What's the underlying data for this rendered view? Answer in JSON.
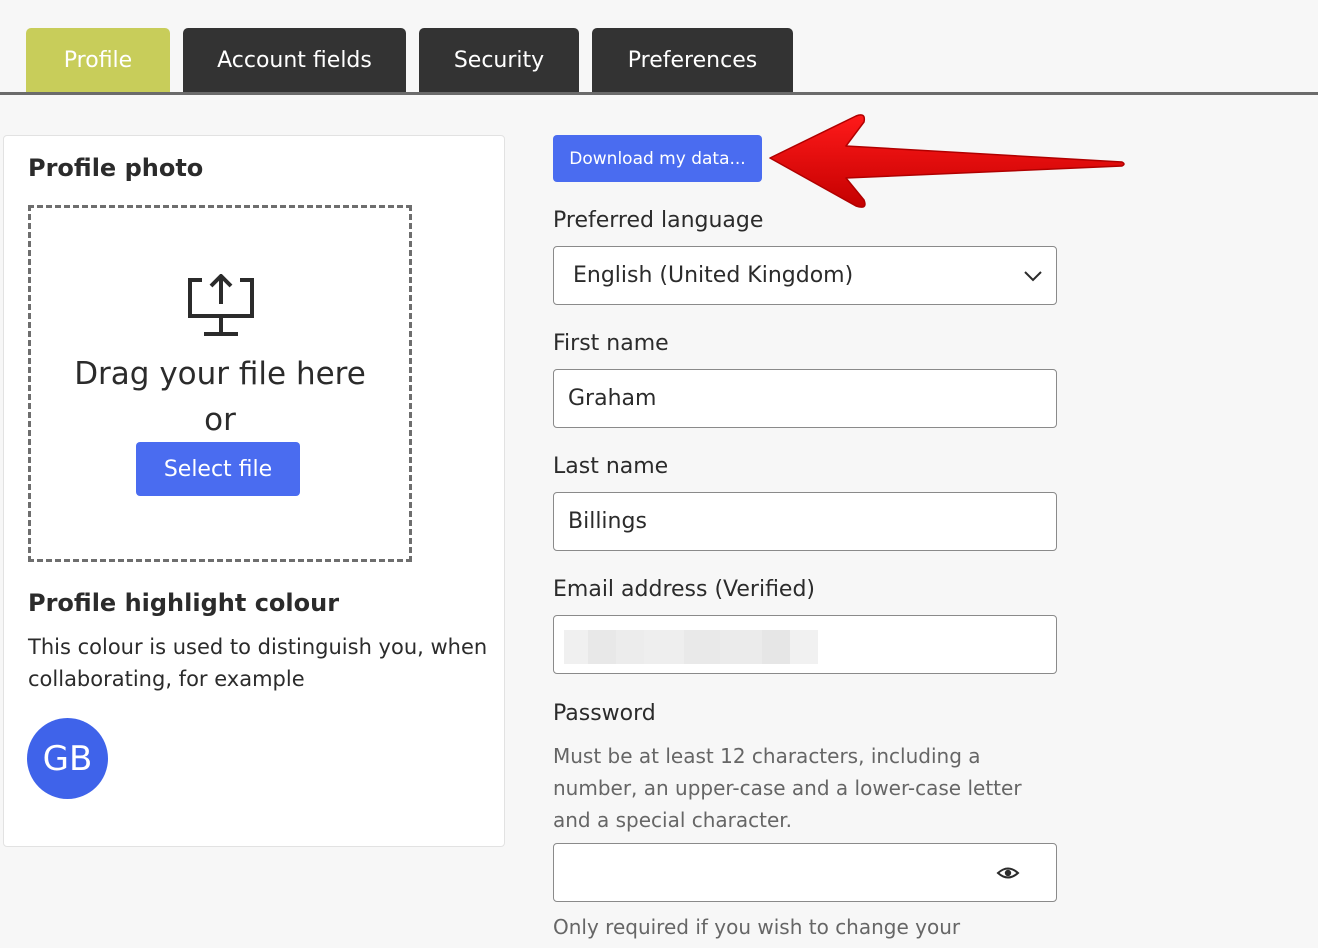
{
  "tabs": [
    {
      "label": "Profile",
      "active": true
    },
    {
      "label": "Account fields",
      "active": false
    },
    {
      "label": "Security",
      "active": false
    },
    {
      "label": "Preferences",
      "active": false
    }
  ],
  "profile_photo": {
    "heading": "Profile photo",
    "drag_text": "Drag your file here",
    "or_text": "or",
    "select_button": "Select file"
  },
  "highlight": {
    "heading": "Profile highlight colour",
    "description": "This colour is used to distinguish you, when collaborating, for example",
    "avatar_initials": "GB",
    "avatar_color": "#3f63ea"
  },
  "download_button": "Download my data...",
  "form": {
    "language_label": "Preferred language",
    "language_value": "English (United Kingdom)",
    "first_name_label": "First name",
    "first_name_value": "Graham",
    "last_name_label": "Last name",
    "last_name_value": "Billings",
    "email_label": "Email address (Verified)",
    "password_label": "Password",
    "password_rules": "Must be at least 12 characters, including a number, an upper-case and a lower-case letter and a special character.",
    "password_hint": "Only required if you wish to change your password."
  },
  "colors": {
    "active_tab": "#c8cd5a",
    "inactive_tab": "#333333",
    "primary_button": "#4a6cf0",
    "annotation_arrow": "#e00000"
  }
}
